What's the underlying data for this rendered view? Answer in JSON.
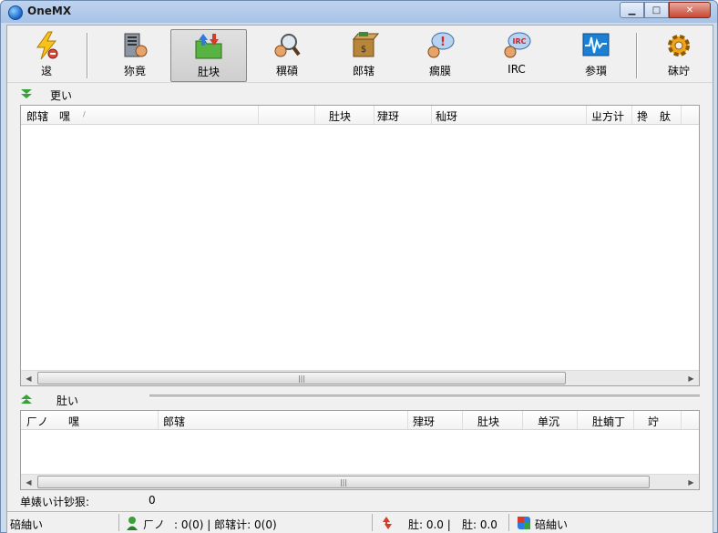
{
  "window": {
    "title": "OneMX"
  },
  "toolbar": {
    "buttons": [
      {
        "id": "connect",
        "label": "逡",
        "icon": "lightning-icon"
      },
      {
        "id": "browse",
        "label": "狝竟",
        "icon": "server-icon"
      },
      {
        "id": "transfer",
        "label": "肚块",
        "icon": "folder-transfer-icon"
      },
      {
        "id": "search",
        "label": "穓碽",
        "icon": "search-icon"
      },
      {
        "id": "library",
        "label": "郎辖",
        "icon": "money-box-icon"
      },
      {
        "id": "chat",
        "label": "瘸膜",
        "icon": "chat-icon"
      },
      {
        "id": "irc",
        "label": "IRC",
        "icon": "irc-icon"
      },
      {
        "id": "stats",
        "label": "参瓆",
        "icon": "graph-icon"
      },
      {
        "id": "options",
        "label": "砞竚",
        "icon": "gear-icon"
      }
    ]
  },
  "downloads": {
    "section_label": "更い",
    "columns": [
      "郎辖",
      "嘿",
      "肚块",
      "肂玡",
      "秈玡",
      "ㄓ方计",
      "搀",
      "舦"
    ],
    "sort_indicator": "/"
  },
  "uploads": {
    "section_label": "肚い",
    "columns": [
      "ㄏノ",
      "嘿",
      "郎辖",
      "肂玡",
      "肚块",
      "单沉",
      "肚蝻丁",
      "竚"
    ]
  },
  "summary": {
    "label": "单婊い计钞狠:",
    "value": "0"
  },
  "statusbar": {
    "left": "碚紬い",
    "users_label": "ㄏノ",
    "users_value": ": 0(0) | 郎辖计: 0(0)",
    "down": "肚: 0.0 |",
    "up": "肚: 0.0",
    "right": "碚紬い"
  },
  "colors": {
    "accent": "#cfdbe9",
    "close": "#c74832"
  }
}
